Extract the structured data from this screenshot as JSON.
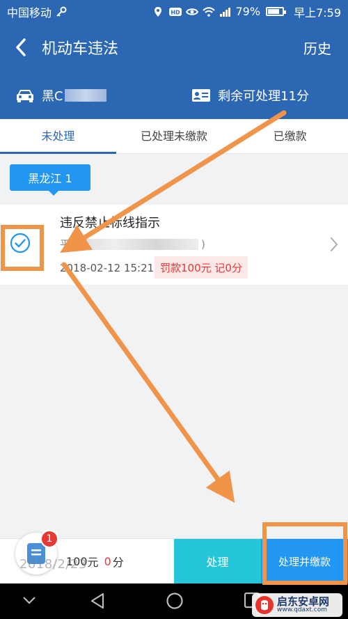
{
  "status_bar": {
    "carrier": "中国移动",
    "battery": "79%",
    "time": "早上7:59"
  },
  "nav": {
    "title": "机动车违法",
    "history": "历史"
  },
  "info": {
    "plate_prefix": "黑C",
    "points_label": "剩余可处理11分"
  },
  "tabs": [
    {
      "label": "未处理",
      "active": true
    },
    {
      "label": "已处理未缴款",
      "active": false
    },
    {
      "label": "已缴款",
      "active": false
    }
  ],
  "region_tag": "黑龙江 1",
  "violation": {
    "title": "违反禁止标线指示",
    "location_prefix": "平",
    "location_suffix": ")",
    "time": "2018-02-12 15:21",
    "penalty": "罚款100元 记0分",
    "checked": true
  },
  "bottom": {
    "amount_prefix": "",
    "amount_value": "100",
    "amount_unit": "元",
    "points_value": "0",
    "points_unit": "分",
    "process_btn": "处理",
    "process_pay_btn": "处理并缴款",
    "badge_count": "1"
  },
  "watermark": {
    "date": "2018/2/23",
    "logo_text": "启东安卓网",
    "logo_url": "www.qdaxt.com"
  },
  "colors": {
    "primary": "#2c67b3",
    "accent": "#2196f3",
    "teal": "#26c6da",
    "danger": "#e53935",
    "annotation": "#f0944a"
  }
}
